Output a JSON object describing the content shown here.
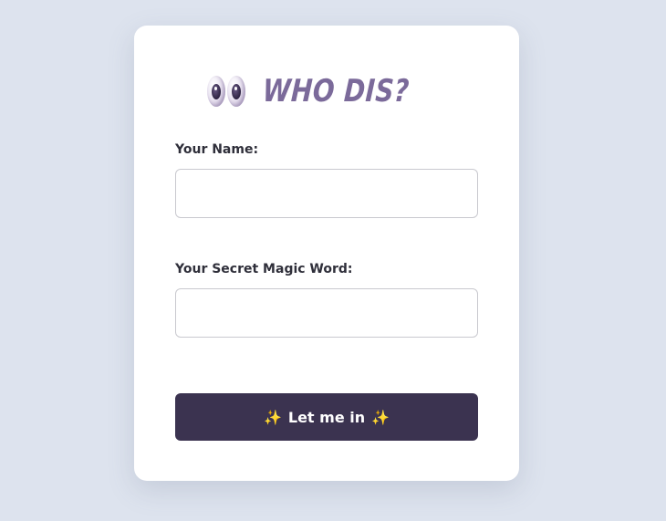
{
  "header": {
    "icon": "eyes-emoji-icon",
    "title": "WHO DIS?"
  },
  "form": {
    "name_label": "Your Name:",
    "name_value": "",
    "secret_label": "Your Secret Magic Word:",
    "secret_value": ""
  },
  "submit": {
    "sparkle_left": "✨",
    "label": "Let me in",
    "sparkle_right": "✨"
  },
  "colors": {
    "background": "#dde3ee",
    "card": "#ffffff",
    "title": "#7b6a9a",
    "button": "#3b3350"
  }
}
